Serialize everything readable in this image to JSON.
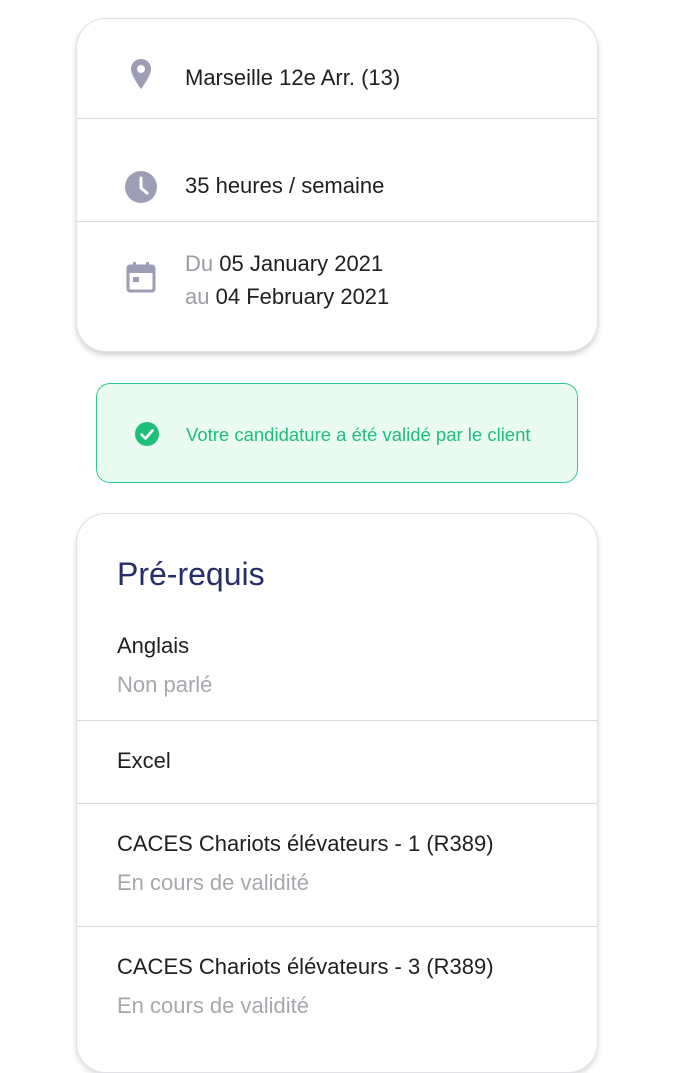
{
  "job_info": {
    "location": "Marseille 12e Arr. (13)",
    "hours": "35 heures / semaine",
    "dates": {
      "from_prefix": "Du",
      "from_value": "05 January 2021",
      "to_prefix": "au",
      "to_value": "04 February 2021"
    },
    "icons": [
      "location-pin-icon",
      "clock-icon",
      "calendar-icon"
    ]
  },
  "banner": {
    "message": "Votre candidature a été validé par le client",
    "icon": "check-circle-icon",
    "color": "#1fbf7a",
    "background": "#e9fbf2"
  },
  "prerequisites": {
    "title": "Pré-requis",
    "items": [
      {
        "name": "Anglais",
        "status": "Non parlé"
      },
      {
        "name": "Excel",
        "status": ""
      },
      {
        "name": "CACES Chariots élévateurs - 1 (R389)",
        "status": "En cours de validité"
      },
      {
        "name": "CACES Chariots élévateurs - 3 (R389)",
        "status": "En cours de validité"
      }
    ]
  },
  "colors": {
    "title": "#262d6b",
    "icon_gray": "#9d9eb6",
    "muted_text": "#a7a7ad"
  }
}
